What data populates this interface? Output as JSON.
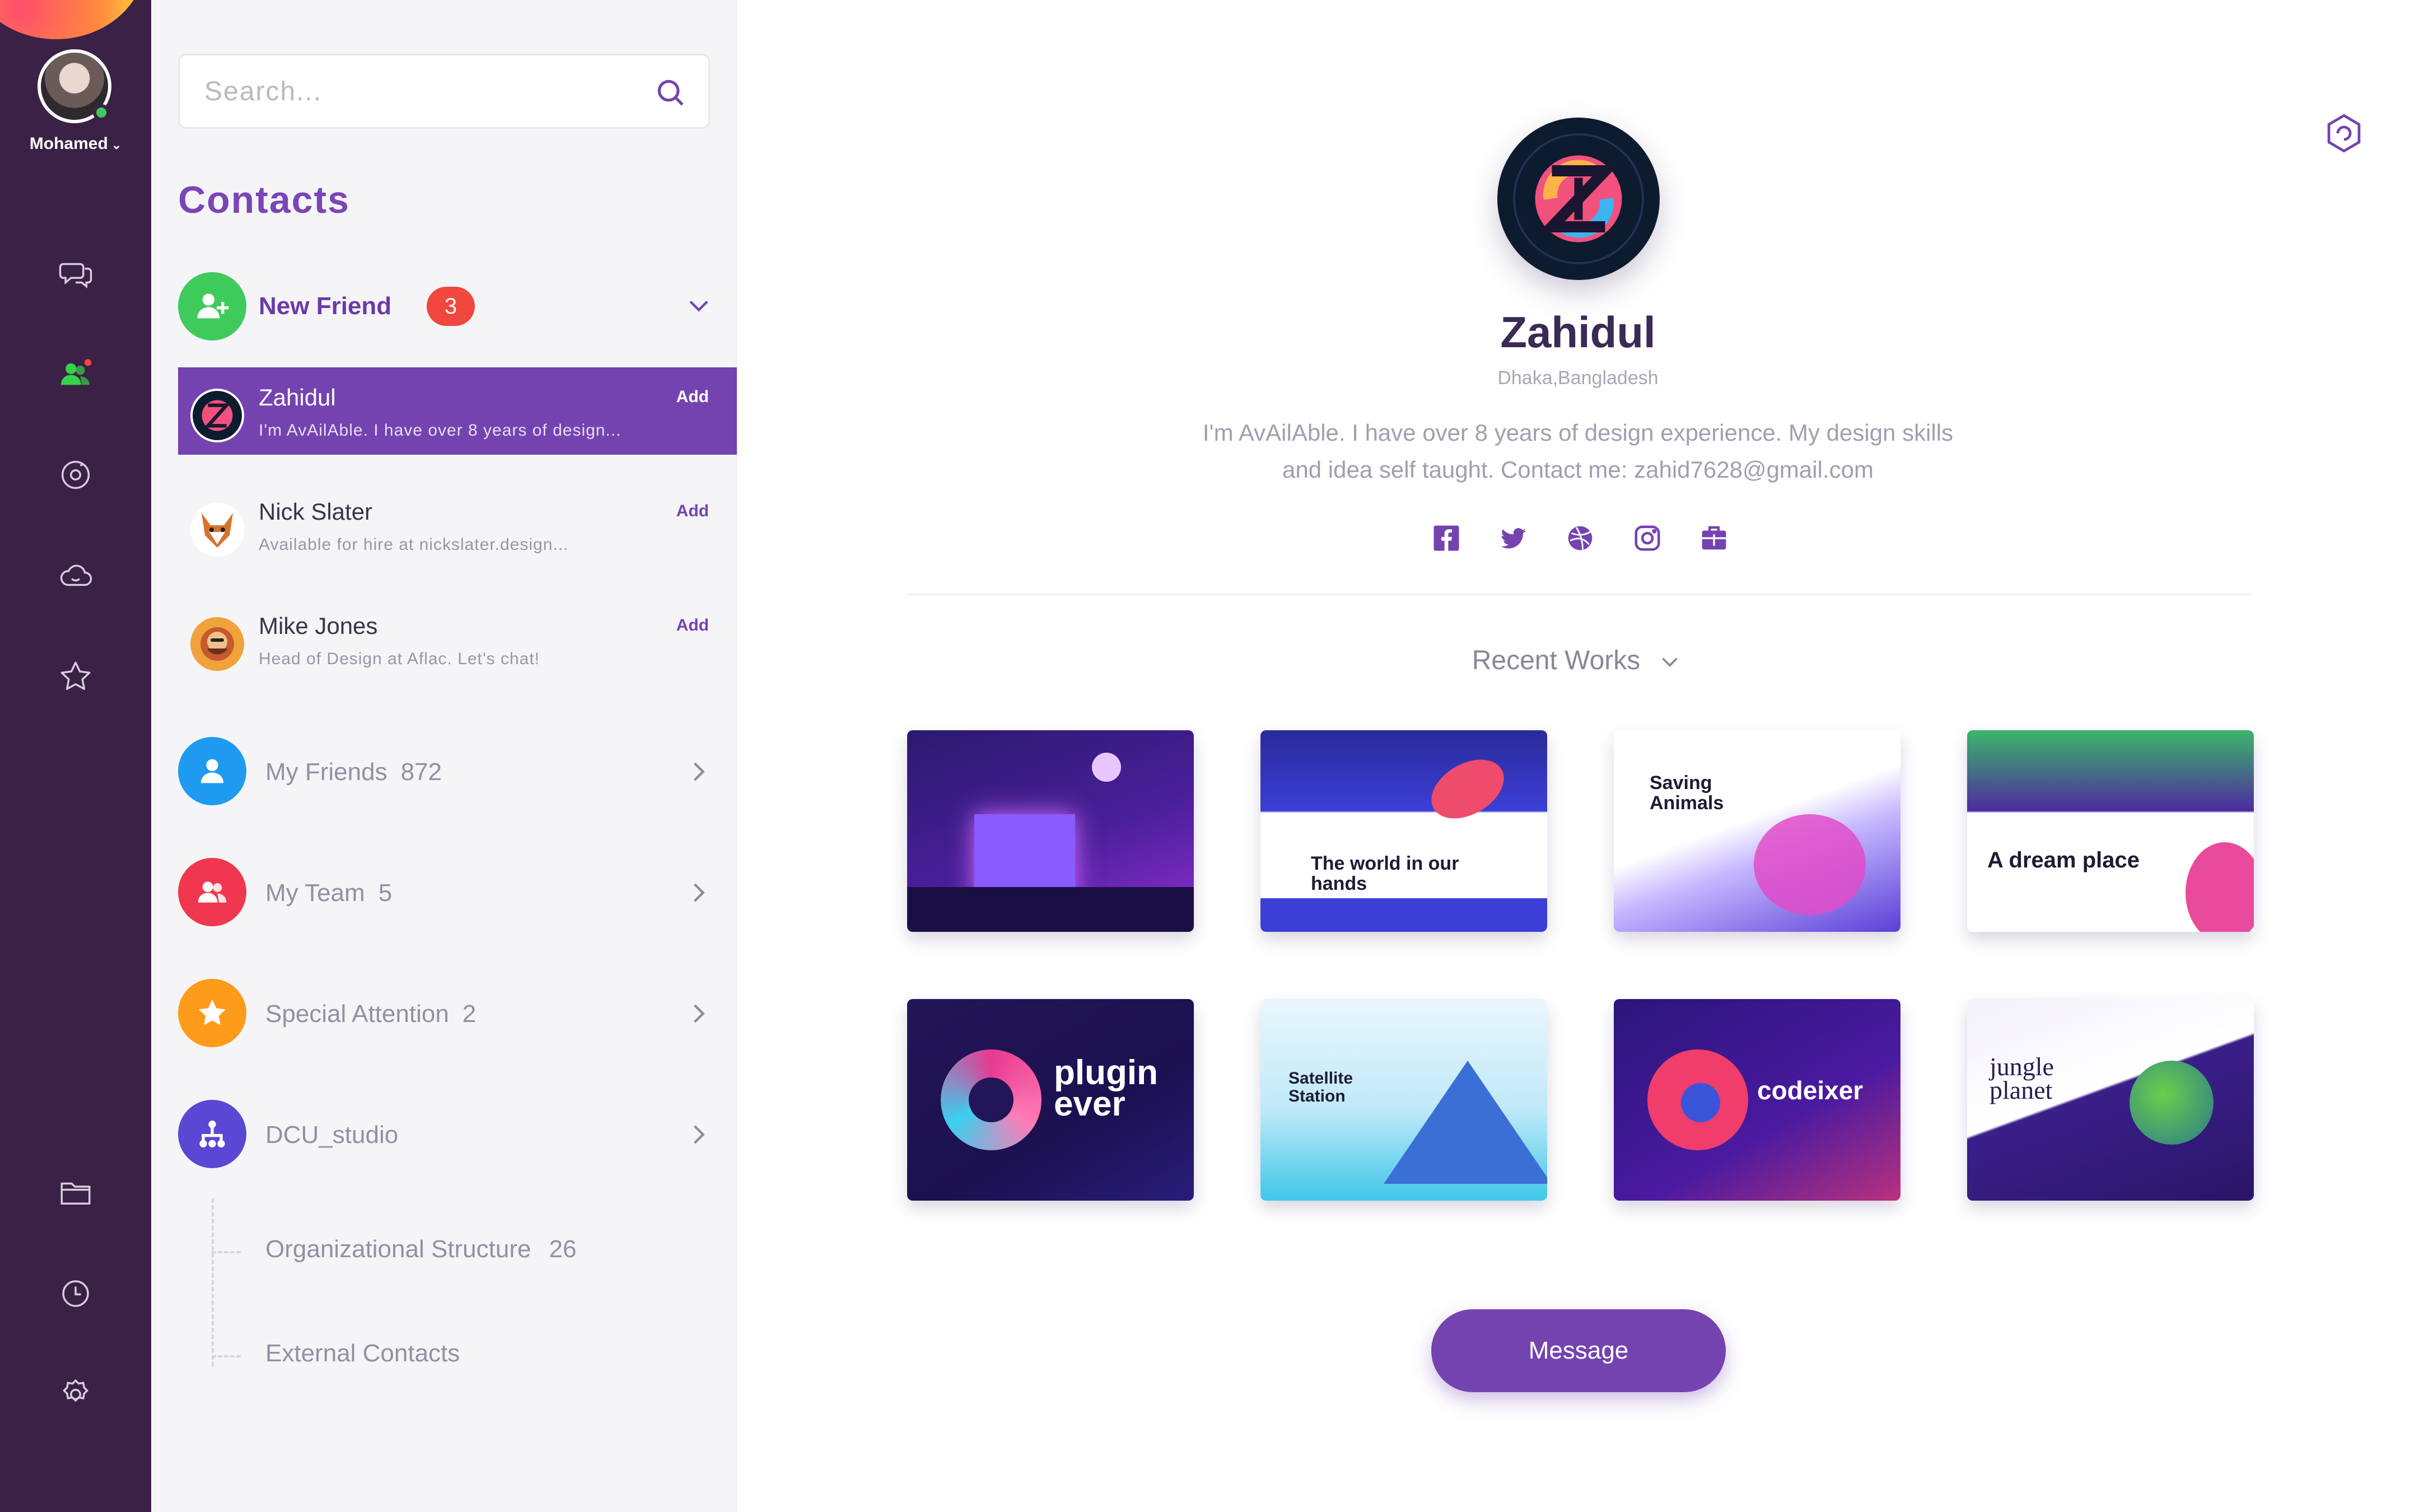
{
  "user": {
    "name": "Mohamed",
    "status": "online"
  },
  "rail": {
    "icons": [
      "chat-icon",
      "contacts-icon",
      "discover-icon",
      "cloud-icon",
      "star-icon",
      "folder-icon",
      "clock-icon",
      "settings-icon"
    ],
    "active": "contacts-icon"
  },
  "search": {
    "placeholder": "Search..."
  },
  "contacts": {
    "title": "Contacts",
    "new_friend": {
      "label": "New Friend",
      "count": "3"
    },
    "requests": [
      {
        "name": "Zahidul",
        "desc": "I'm AvAilAble. I have over 8 years of design...",
        "action": "Add",
        "active": true
      },
      {
        "name": "Nick Slater",
        "desc": "Available for hire at nickslater.design...",
        "action": "Add",
        "active": false
      },
      {
        "name": "Mike Jones",
        "desc": "Head of Design at Aflac. Let's chat!",
        "action": "Add",
        "active": false
      }
    ],
    "groups": [
      {
        "label": "My Friends",
        "count": "872",
        "color": "#1e9bf0"
      },
      {
        "label": "My Team",
        "count": "5",
        "color": "#f0374f"
      },
      {
        "label": "Special Attention",
        "count": "2",
        "color": "#ff9b1a"
      },
      {
        "label": "DCU_studio",
        "count": "",
        "color": "#5a48d4"
      }
    ],
    "sub_groups": [
      {
        "label": "Organizational Structure",
        "count": "26"
      },
      {
        "label": "External Contacts",
        "count": ""
      }
    ]
  },
  "profile": {
    "name": "Zahidul",
    "location": "Dhaka,Bangladesh",
    "bio_line1": "I'm AvAilAble. I have over 8 years of design experience. My design skills",
    "bio_line2": "and idea self taught. Contact me: zahid7628@gmail.com",
    "socials": [
      "facebook-icon",
      "twitter-icon",
      "dribbble-icon",
      "instagram-icon",
      "portfolio-icon"
    ],
    "recent_works_label": "Recent Works",
    "works": [
      {
        "title": "",
        "colors": [
          "#2a1a6e",
          "#6a2bb8",
          "#c04be0"
        ]
      },
      {
        "title": "The world in our hands",
        "colors": [
          "#ffffff",
          "#3b3fd6",
          "#ef4b6c"
        ]
      },
      {
        "title": "Saving Animals",
        "colors": [
          "#ffffff",
          "#5a3fd6",
          "#e04cc9"
        ]
      },
      {
        "title": "A dream place",
        "colors": [
          "#ffffff",
          "#3cb56b",
          "#e94b9c"
        ]
      },
      {
        "title": "plugin ever",
        "colors": [
          "#231658",
          "#e83a8f",
          "#3ad0f0"
        ]
      },
      {
        "title": "Satellite Station",
        "colors": [
          "#dff3fb",
          "#3b6fd6",
          "#7ce3f5"
        ]
      },
      {
        "title": "codeixer",
        "colors": [
          "#2a157a",
          "#f03d6b",
          "#7a2bd0"
        ]
      },
      {
        "title": "jungle planet",
        "colors": [
          "#f4f1fb",
          "#3a1f8a",
          "#6bcf4a"
        ]
      }
    ],
    "message_label": "Message"
  },
  "colors": {
    "accent": "#7443b0",
    "rail": "#3a2145",
    "badge": "#f0473e",
    "new_friend_green": "#3ecb5c"
  }
}
